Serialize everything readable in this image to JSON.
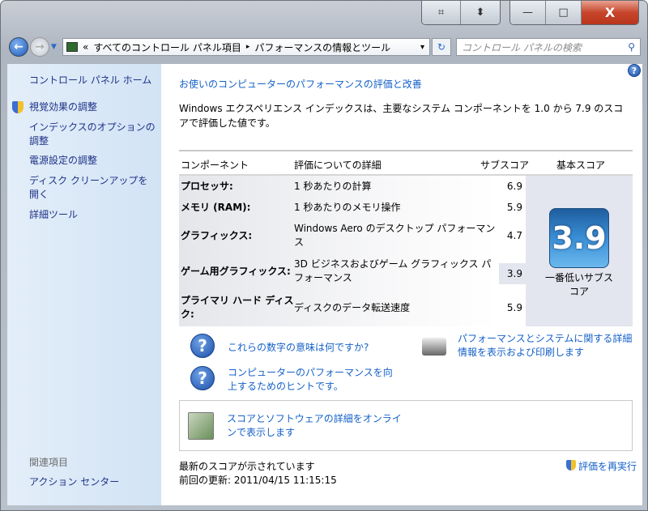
{
  "window": {
    "snap_icon": "snap-icon",
    "resize_icon": "resize-icon",
    "minimize": "—",
    "maximize": "□",
    "close": "X"
  },
  "address": {
    "chevron": "«",
    "crumbs": [
      "すべてのコントロール パネル項目",
      "パフォーマンスの情報とツール"
    ],
    "sep": "▸",
    "dropdown": "▾",
    "refresh": "↻",
    "search_placeholder": "コントロール パネルの検索",
    "search_icon": "⚲"
  },
  "sidebar": {
    "home": "コントロール パネル ホーム",
    "items": [
      "視覚効果の調整",
      "インデックスのオプションの調整",
      "電源設定の調整",
      "ディスク クリーンアップを開く",
      "詳細ツール"
    ],
    "related_heading": "関連項目",
    "related": [
      "アクション センター"
    ]
  },
  "main": {
    "title": "お使いのコンピューターのパフォーマンスの評価と改善",
    "description": "Windows エクスペリエンス インデックスは、主要なシステム コンポーネントを 1.0 から 7.9 のスコアで評価した値です。",
    "help": "?",
    "table": {
      "headers": [
        "コンポーネント",
        "評価についての詳細",
        "サブスコア",
        "基本スコア"
      ],
      "rows": [
        {
          "component": "プロセッサ:",
          "detail": "1 秒あたりの計算",
          "subscore": "6.9"
        },
        {
          "component": "メモリ (RAM):",
          "detail": "1 秒あたりのメモリ操作",
          "subscore": "5.9"
        },
        {
          "component": "グラフィックス:",
          "detail": "Windows Aero のデスクトップ パフォーマンス",
          "subscore": "4.7"
        },
        {
          "component": "ゲーム用グラフィックス:",
          "detail": "3D ビジネスおよびゲーム グラフィックス パフォーマンス",
          "subscore": "3.9"
        },
        {
          "component": "プライマリ ハード ディスク:",
          "detail": "ディスクのデータ転送速度",
          "subscore": "5.9"
        }
      ],
      "base_score": "3.9",
      "base_caption": "一番低いサブスコア"
    },
    "links": {
      "meaning": "これらの数字の意味は何ですか?",
      "tips": "コンピューターのパフォーマンスを向上するためのヒントです。",
      "print": "パフォーマンスとシステムに関する詳細情報を表示および印刷します",
      "online": "スコアとソフトウェアの詳細をオンラインで表示します"
    },
    "status": "最新のスコアが示されています",
    "last_update_label": "前回の更新:",
    "last_update": "2011/04/15 11:15:15",
    "rerun": "評価を再実行"
  }
}
